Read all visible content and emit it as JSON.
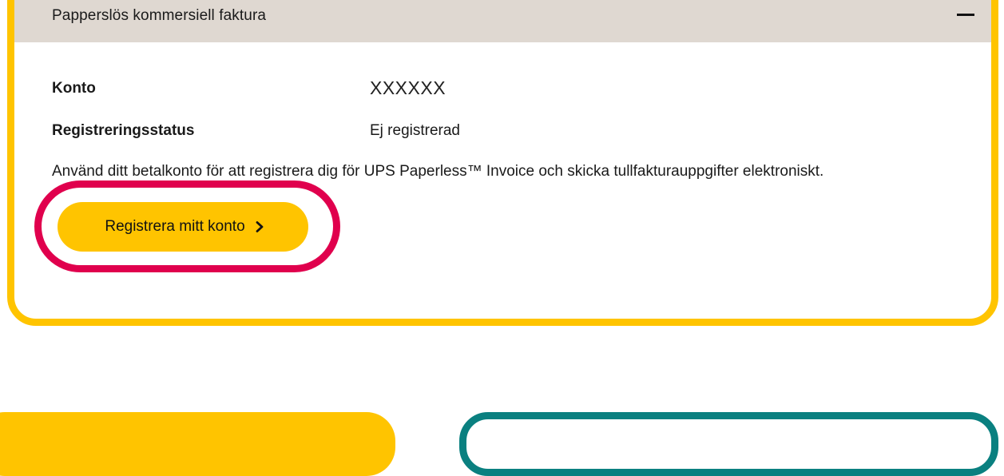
{
  "card": {
    "title": "Papperslös kommersiell faktura",
    "collapse_icon": "minus-icon"
  },
  "fields": {
    "account_label": "Konto",
    "account_value": "XXXXXX",
    "status_label": "Registreringsstatus",
    "status_value": "Ej registrerad"
  },
  "description": "Använd ditt betalkonto för att registrera dig för UPS Paperless™ Invoice och skicka tullfakturauppgifter elektroniskt.",
  "register_button": {
    "label": "Registrera mitt konto",
    "icon": "chevron-right-icon"
  },
  "colors": {
    "card_border": "#ffc400",
    "header_background": "#dfd8d1",
    "button_background": "#ffc400",
    "highlight_ring": "#e0004d",
    "teal_panel_border": "#0a8080"
  }
}
